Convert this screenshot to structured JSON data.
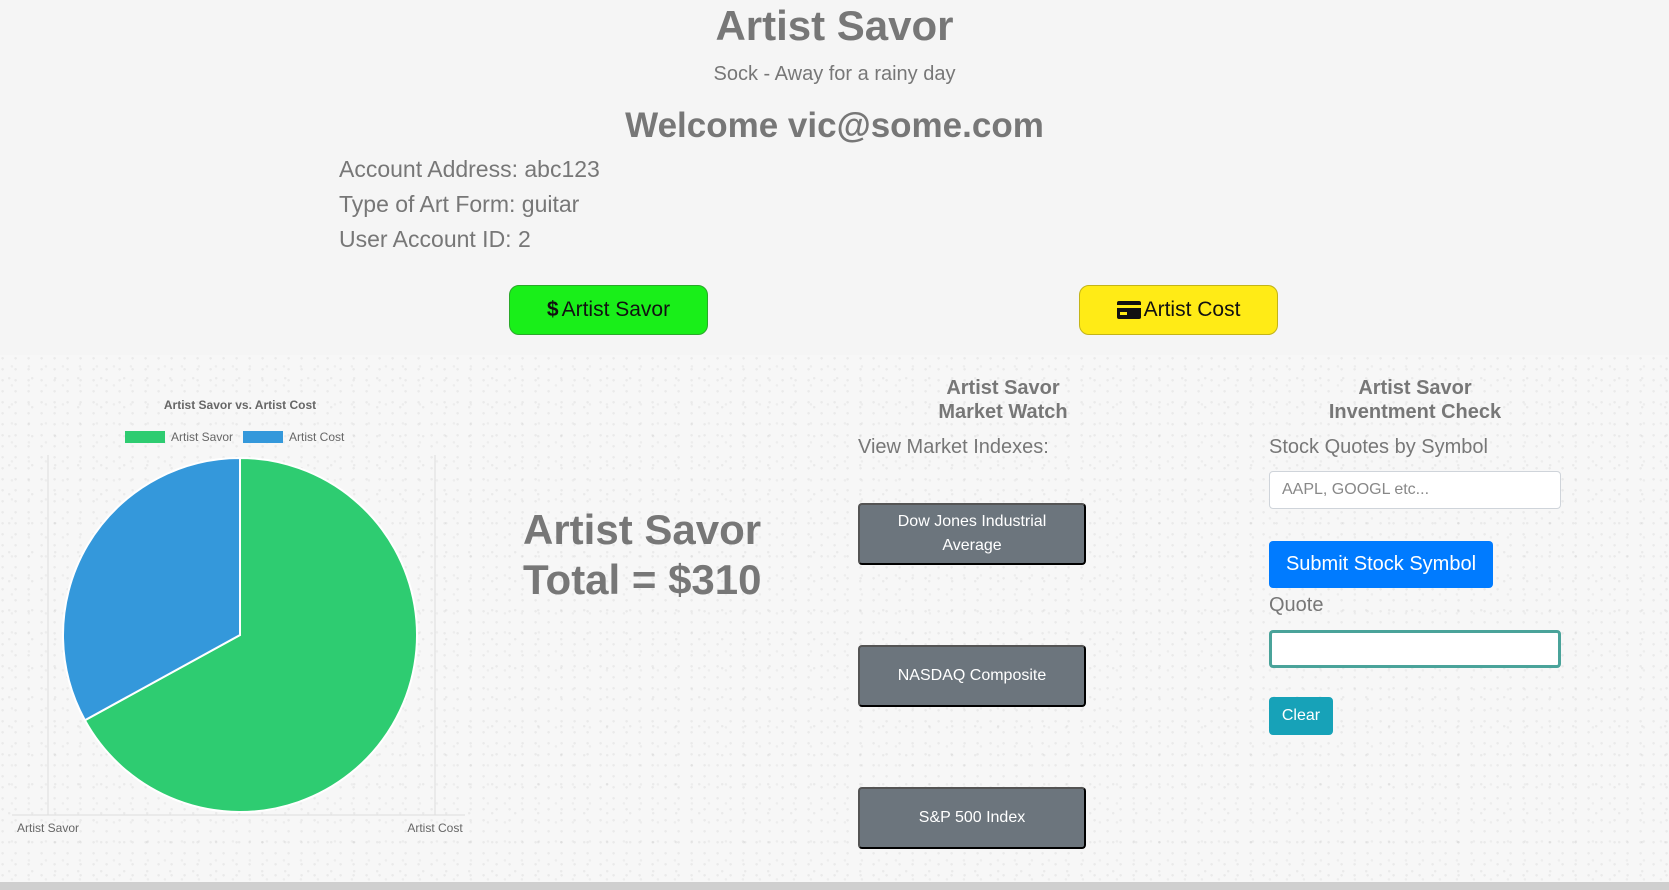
{
  "header": {
    "title": "Artist Savor",
    "subtitle": "Sock - Away for a rainy day",
    "welcome": "Welcome vic@some.com",
    "account_address": "Account Address: abc123",
    "art_form": "Type of Art Form: guitar",
    "user_id": "User Account ID: 2",
    "savor_button": {
      "icon": "dollar-icon",
      "glyph": "$",
      "label": "Artist Savor",
      "color": "#19ef19"
    },
    "cost_button": {
      "icon": "credit-card-icon",
      "label": "Artist Cost",
      "color": "#ffeb16"
    }
  },
  "total": {
    "line1": "Artist Savor",
    "line2": "Total = $310"
  },
  "market_watch": {
    "heading_line1": "Artist Savor",
    "heading_line2": "Market Watch",
    "label": "View Market Indexes:",
    "indexes": [
      "Dow Jones Industrial Average",
      "NASDAQ Composite",
      "S&P 500 Index"
    ]
  },
  "inventment": {
    "heading_line1": "Artist Savor",
    "heading_line2": "Inventment Check",
    "quotes_label": "Stock Quotes by Symbol",
    "symbol_placeholder": "AAPL, GOOGL etc...",
    "submit_label": "Submit Stock Symbol",
    "quote_label": "Quote",
    "quote_value": "",
    "clear_label": "Clear"
  },
  "chart_data": {
    "type": "pie",
    "title": "Artist Savor vs. Artist Cost",
    "categories": [
      "Artist Savor",
      "Artist Cost"
    ],
    "values": [
      67,
      33
    ],
    "colors": [
      "#2ecc71",
      "#3498db"
    ],
    "legend": "top",
    "xlabels": [
      "Artist Savor",
      "Artist Cost"
    ]
  }
}
